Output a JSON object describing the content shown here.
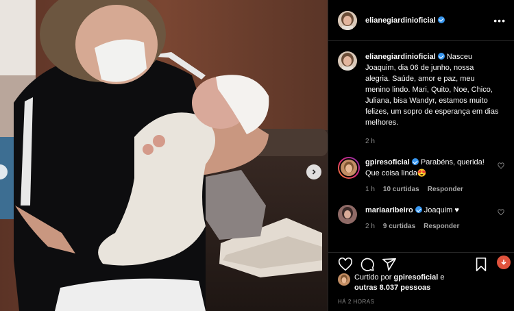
{
  "post": {
    "username": "elianegiardinioficial",
    "caption": "Nasceu Joaquim, dia 06 de junho, nossa alegria. Saúde, amor e paz, meu menino lindo. Mari, Quito, Noe, Chico, Juliana, bisa Wandyr, estamos muito felizes, um sopro de esperança em dias melhores.",
    "caption_time": "2 h"
  },
  "comments": [
    {
      "username": "gpiresoficial",
      "text": "Parabéns, querida! Que coisa linda😍",
      "time": "1 h",
      "likes": "10 curtidas",
      "reply": "Responder"
    },
    {
      "username": "mariaaribeiro",
      "text": "Joaquim ♥",
      "time": "2 h",
      "likes": "9 curtidas",
      "reply": "Responder"
    }
  ],
  "likes": {
    "prefix": "Curtido por",
    "by": "gpiresoficial",
    "joiner": "e",
    "others": "outras 8.037 pessoas"
  },
  "time_ago": "HÁ 2 HORAS",
  "icons": [
    "more-options-icon",
    "heart-icon",
    "comment-icon",
    "share-icon",
    "bookmark-icon",
    "next-arrow-icon",
    "verified-icon"
  ],
  "colors": {
    "verified": "#3897f0",
    "muted": "#8e8e8e",
    "panel_bg": "#000000"
  }
}
